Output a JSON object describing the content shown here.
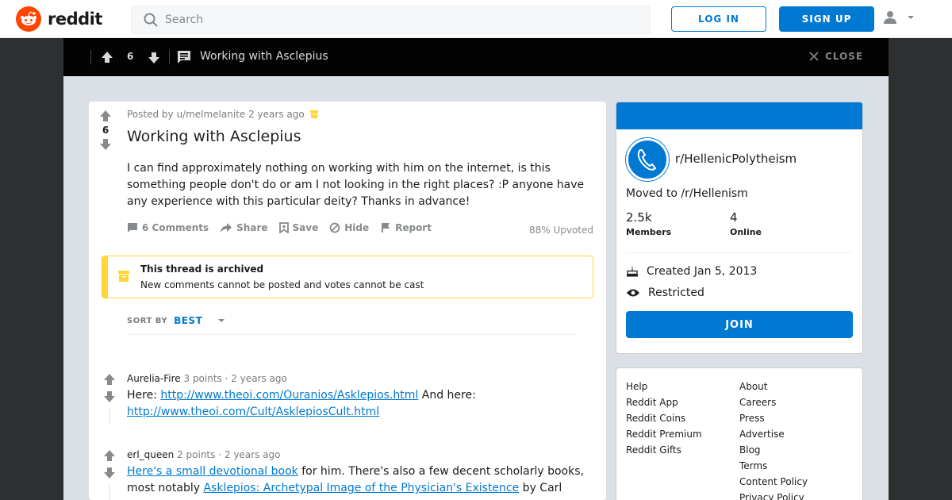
{
  "header": {
    "logo_text": "reddit",
    "search_placeholder": "Search",
    "login_label": "LOG IN",
    "signup_label": "SIGN UP"
  },
  "postbar": {
    "vote_count": "6",
    "title": "Working with Asclepius",
    "close_label": "CLOSE"
  },
  "post": {
    "score": "6",
    "meta": "Posted by u/melmelanite 2 years ago",
    "title": "Working with Asclepius",
    "body": "I can find approximately nothing on working with him on the internet, is this something people don't do or am I not looking in the right places? :P anyone have any experience with this particular deity? Thanks in advance!",
    "actions": {
      "comments": "6 Comments",
      "share": "Share",
      "save": "Save",
      "hide": "Hide",
      "report": "Report"
    },
    "upvoted": "88% Upvoted",
    "archived_title": "This thread is archived",
    "archived_sub": "New comments cannot be posted and votes cannot be cast",
    "sort_label": "SORT BY",
    "sort_value": "BEST"
  },
  "comments": [
    {
      "author": "Aurelia-Fire",
      "points": "3 points",
      "time": "2 years ago",
      "text_1": "Here: ",
      "link_1": "http://www.theoi.com/Ouranios/Asklepios.html",
      "text_2": " And here: ",
      "link_2": "http://www.theoi.com/Cult/AsklepiosCult.html"
    },
    {
      "author": "erl_queen",
      "points": "2 points",
      "time": "2 years ago",
      "link_1": "Here's a small devotional book",
      "text_1": " for him. There's also a few decent scholarly books, most notably ",
      "link_2": "Asklepios: Archetypal Image of the Physician's Existence",
      "text_2": " by Carl"
    }
  ],
  "sidebar": {
    "name": "r/HellenicPolytheism",
    "description": "Moved to /r/Hellenism",
    "members_num": "2.5k",
    "members_label": "Members",
    "online_num": "4",
    "online_label": "Online",
    "created": "Created Jan 5, 2013",
    "restricted": "Restricted",
    "join_label": "JOIN"
  },
  "footer_links": {
    "left": [
      "Help",
      "Reddit App",
      "Reddit Coins",
      "Reddit Premium",
      "Reddit Gifts"
    ],
    "right": [
      "About",
      "Careers",
      "Press",
      "Advertise",
      "Blog",
      "Terms",
      "Content Policy",
      "Privacy Policy"
    ]
  },
  "colors": {
    "brand": "#ff4500",
    "accent": "#0079d3",
    "archived": "#ffd635"
  }
}
